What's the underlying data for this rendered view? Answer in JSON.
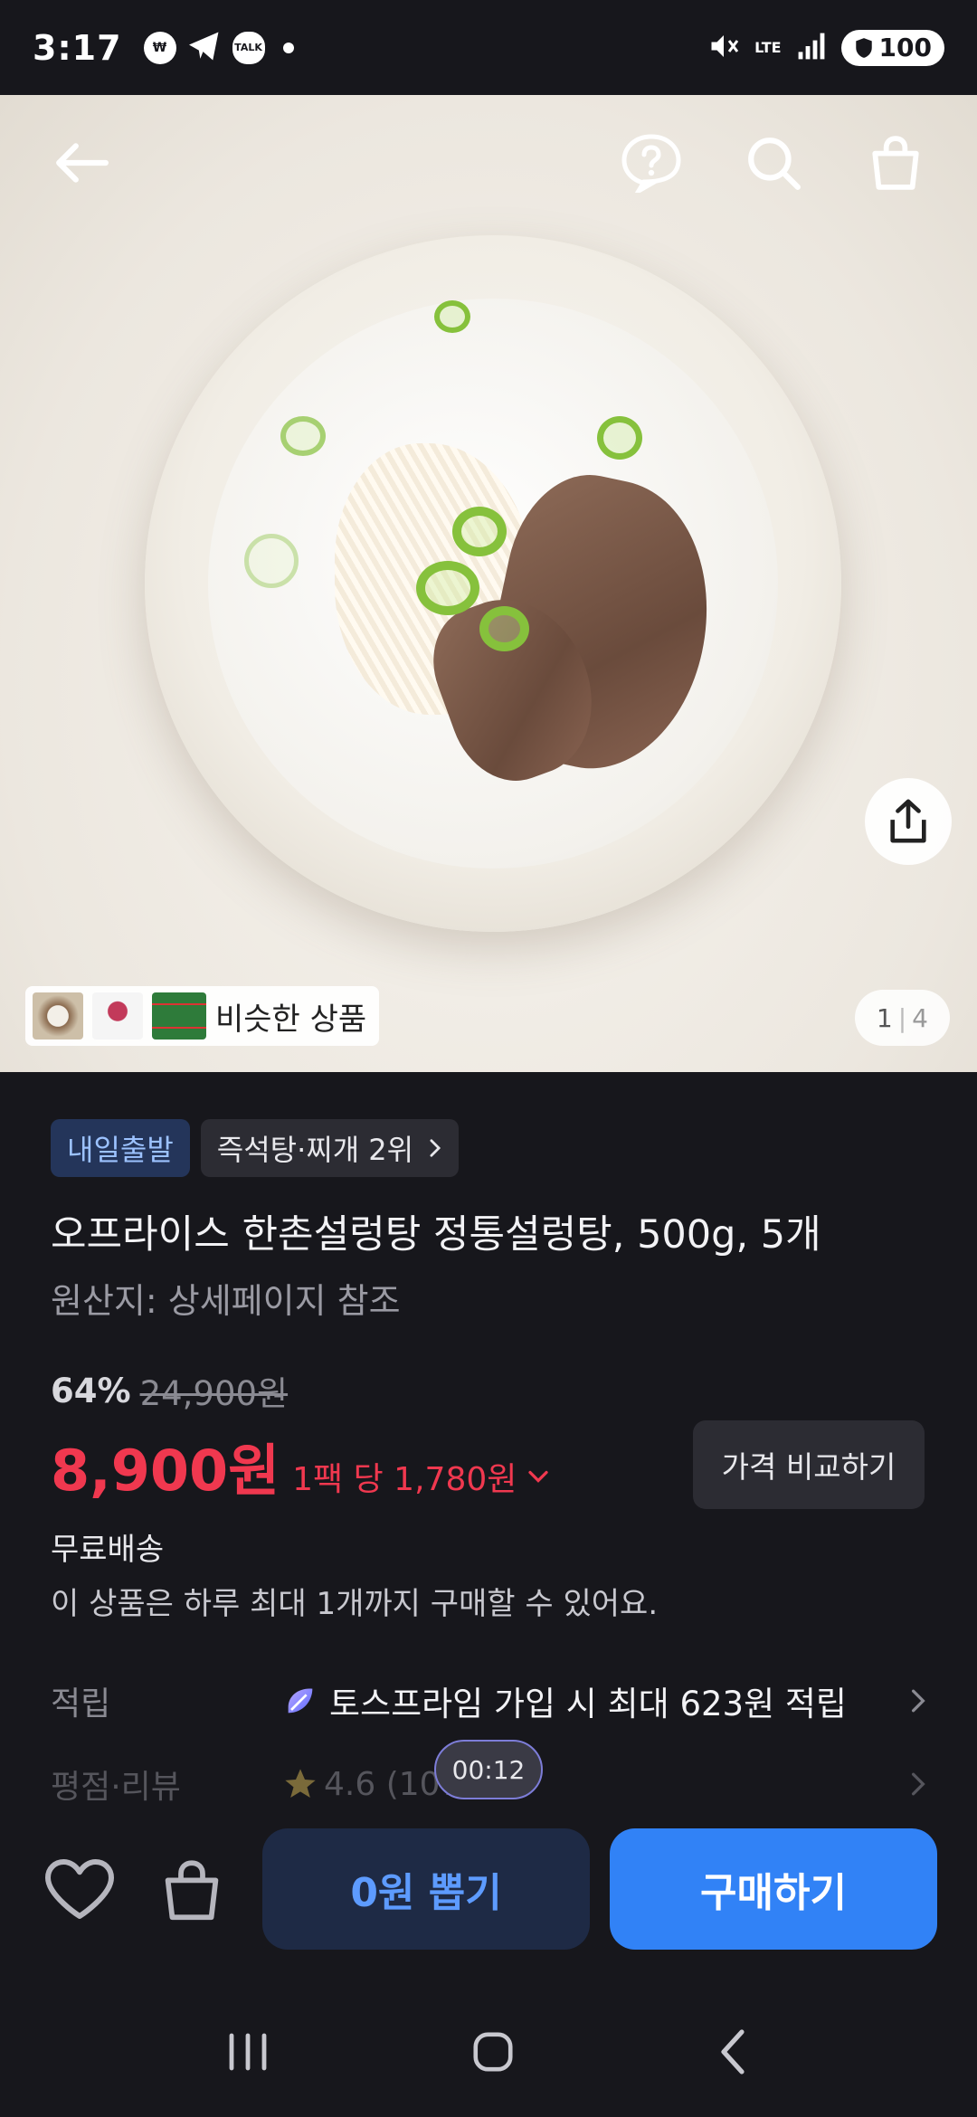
{
  "status_bar": {
    "time": "3:17",
    "left_icons": [
      "bank-app-icon",
      "telegram-icon",
      "kakaotalk-icon"
    ],
    "talk_icon_text": "TALK",
    "network": "LTE",
    "battery": "100"
  },
  "hero": {
    "image_alt": "bowl-of-seolleongtang",
    "similar_label": "비슷한 상품",
    "page_current": "1",
    "page_total": "4"
  },
  "product": {
    "badge_delivery": "내일출발",
    "badge_rank": "즉석탕·찌개 2위",
    "title": "오프라이스 한촌설렁탕 정통설렁탕, 500g, 5개",
    "origin": "원산지: 상세페이지 참조",
    "discount_pct": "64%",
    "original_price": "24,900원",
    "price": "8,900원",
    "unit_price": "1팩 당 1,780원",
    "compare_label": "가격 비교하기",
    "shipping": "무료배송",
    "purchase_limit": "이 상품은 하루 최대 1개까지 구매할 수 있어요.",
    "reward_label": "적립",
    "reward_text": "토스프라임 가입 시 최대 623원 적립",
    "rating_label": "평점·리뷰",
    "rating_value": "4.6 (107)",
    "timer": "00:12"
  },
  "bottom_bar": {
    "lottery_label": "0원 뽑기",
    "buy_label": "구매하기"
  },
  "colors": {
    "background": "#17171c",
    "price_red": "#f0384f",
    "buy_blue": "#3182f6",
    "lottery_bg": "#1e2a45"
  }
}
